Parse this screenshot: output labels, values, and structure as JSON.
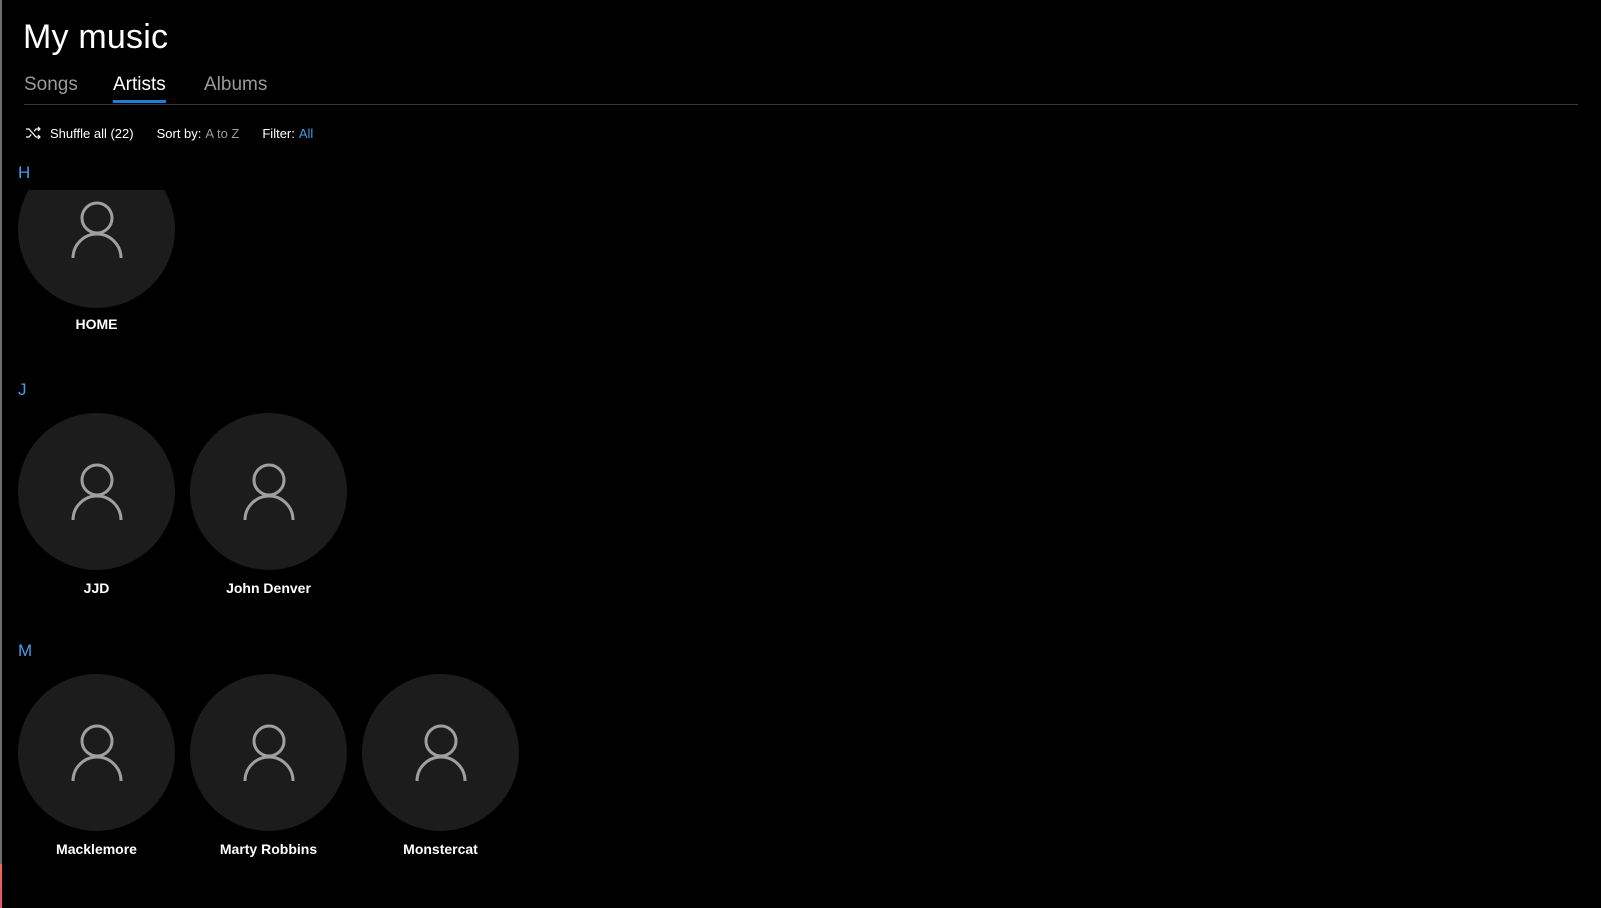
{
  "page_title": "My music",
  "tabs": [
    {
      "label": "Songs",
      "active": false
    },
    {
      "label": "Artists",
      "active": true
    },
    {
      "label": "Albums",
      "active": false
    }
  ],
  "toolbar": {
    "shuffle_icon": "shuffle-icon",
    "shuffle_label": "Shuffle all (22)",
    "sort_label": "Sort by:",
    "sort_value": "A to Z",
    "filter_label": "Filter:",
    "filter_value": "All"
  },
  "colors": {
    "accent": "#1f7fd6",
    "link": "#4a9be8",
    "tile": "#1c1c1c",
    "background": "#000000"
  },
  "groups": [
    {
      "letter": "H",
      "artists": [
        {
          "name": "HOME",
          "icon": "person-icon"
        }
      ]
    },
    {
      "letter": "J",
      "artists": [
        {
          "name": "JJD",
          "icon": "person-icon"
        },
        {
          "name": "John Denver",
          "icon": "person-icon"
        }
      ]
    },
    {
      "letter": "M",
      "artists": [
        {
          "name": "Macklemore",
          "icon": "person-icon"
        },
        {
          "name": "Marty Robbins",
          "icon": "person-icon"
        },
        {
          "name": "Monstercat",
          "icon": "person-icon"
        }
      ]
    }
  ]
}
